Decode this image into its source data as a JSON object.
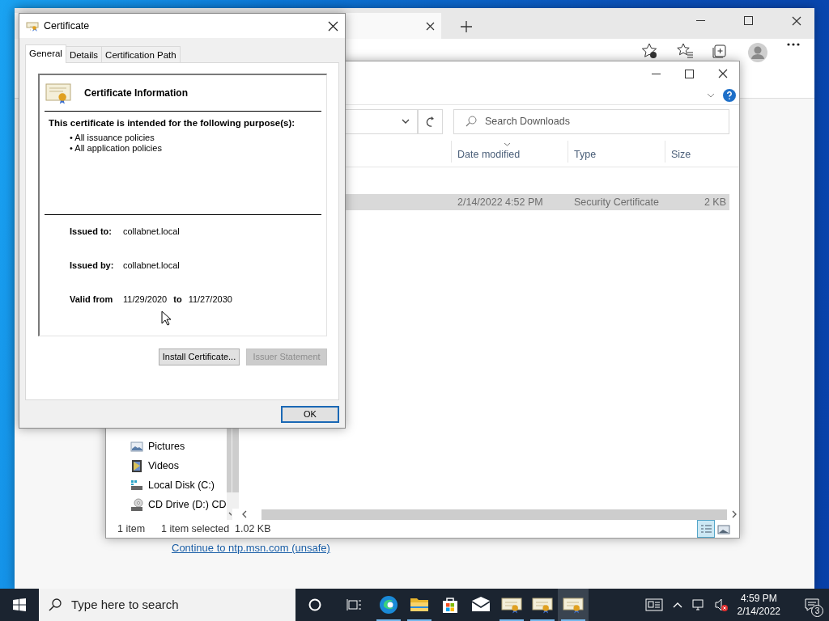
{
  "browser": {
    "link": "Continue to ntp.msn.com (unsafe)"
  },
  "explorer": {
    "search": {
      "placeholder": "Search Downloads"
    },
    "columns": [
      "Date modified",
      "Type",
      "Size"
    ],
    "rows": [
      {
        "cells": [
          "2/14/2022 4:52 PM",
          "Security Certificate",
          "2 KB"
        ],
        "selected": true
      }
    ],
    "nav_items": [
      {
        "label": "Pictures",
        "kind": "pictures"
      },
      {
        "label": "Videos",
        "kind": "videos"
      },
      {
        "label": "Local Disk (C:)",
        "kind": "disk"
      },
      {
        "label": "CD Drive (D:) CD",
        "kind": "cd"
      }
    ],
    "status": {
      "count": "1 item",
      "selection": "1 item selected  1.02 KB"
    },
    "view_modes": [
      {
        "kind": "details",
        "selected": true
      },
      {
        "kind": "large",
        "selected": false
      }
    ]
  },
  "dialog": {
    "title": "Certificate",
    "tabs": [
      {
        "label": "General",
        "selected": true
      },
      {
        "label": "Details",
        "selected": false
      },
      {
        "label": "Certification Path",
        "selected": false
      }
    ],
    "heading": "Certificate Information",
    "purpose_heading": "This certificate is intended for the following purpose(s):",
    "purposes": [
      "• All issuance policies",
      "• All application policies"
    ],
    "fields": [
      {
        "label": "Issued to:",
        "value": "collabnet.local"
      },
      {
        "label": "Issued by:",
        "value": "collabnet.local"
      }
    ],
    "validity": {
      "label": "Valid from",
      "from": "11/29/2020",
      "to_label": "to",
      "to": "11/27/2030"
    },
    "buttons": [
      {
        "label": "Install Certificate...",
        "disabled": false
      },
      {
        "label": "Issuer Statement",
        "disabled": true
      }
    ],
    "ok": "OK"
  },
  "taskbar": {
    "search_placeholder": "Type here to search",
    "apps": [
      {
        "kind": "edge",
        "running": true,
        "selected": false
      },
      {
        "kind": "folder",
        "running": true,
        "selected": false
      },
      {
        "kind": "store",
        "running": false,
        "selected": false
      },
      {
        "kind": "mail",
        "running": false,
        "selected": false
      },
      {
        "kind": "certificate",
        "running": true,
        "selected": false
      },
      {
        "kind": "certificate",
        "running": true,
        "selected": false
      },
      {
        "kind": "certificate",
        "running": true,
        "selected": true
      }
    ],
    "time": "4:59 PM",
    "date": "2/14/2022",
    "notification_count": "3"
  }
}
